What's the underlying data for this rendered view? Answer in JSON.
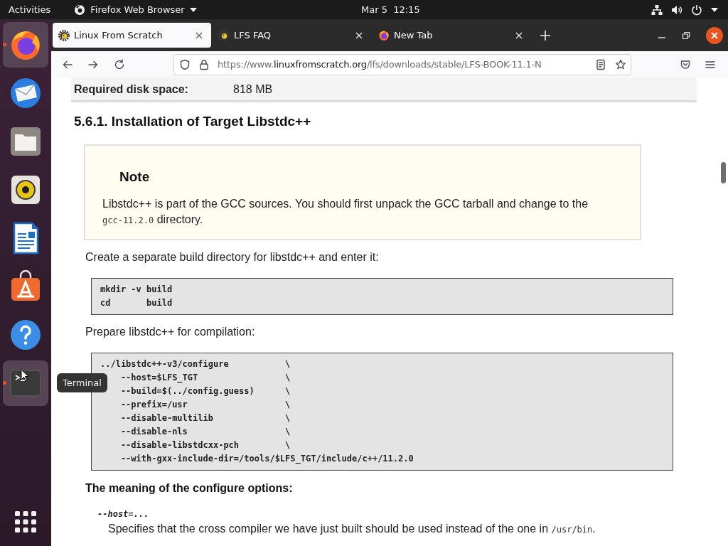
{
  "top_bar": {
    "activities": "Activities",
    "app_menu": "Firefox Web Browser",
    "clock": "Mar 5  12:15"
  },
  "dock": {
    "items": [
      {
        "kind": "browser",
        "running": true,
        "highlighted": true
      },
      {
        "kind": "mail",
        "running": false,
        "highlighted": false
      },
      {
        "kind": "files",
        "running": false,
        "highlighted": false
      },
      {
        "kind": "music",
        "running": false,
        "highlighted": false
      },
      {
        "kind": "writer",
        "running": false,
        "highlighted": false
      },
      {
        "kind": "software",
        "running": false,
        "highlighted": false
      },
      {
        "kind": "help",
        "running": false,
        "highlighted": false
      },
      {
        "kind": "terminal",
        "running": true,
        "highlighted": true
      }
    ],
    "tooltip": "Terminal"
  },
  "tabs": [
    {
      "title": "Linux From Scratch",
      "kind": "lfs",
      "selected": true
    },
    {
      "title": "LFS FAQ",
      "kind": "lfs",
      "selected": false
    },
    {
      "title": "New Tab",
      "kind": "browser",
      "selected": false
    }
  ],
  "address_bar": {
    "prefix": "https://www.",
    "domain": "linuxfromscratch.org",
    "path": "/lfs/downloads/stable/LFS-BOOK-11.1-N"
  },
  "page": {
    "blocks": [
      {
        "kind": "info_row",
        "label": "Required disk space:",
        "value": "818 MB"
      },
      {
        "kind": "heading",
        "text": "5.6.1. Installation of Target Libstdc++"
      },
      {
        "kind": "note",
        "title": "Note",
        "segments": [
          {
            "kind": "text",
            "text": "Libstdc++ is part of the GCC sources. You should first unpack the GCC tarball and change to the "
          },
          {
            "kind": "code",
            "text": "gcc-11.2.0"
          },
          {
            "kind": "text",
            "text": " directory."
          }
        ]
      },
      {
        "kind": "paragraph",
        "text": "Create a separate build directory for libstdc++ and enter it:"
      },
      {
        "kind": "code_block",
        "lines": [
          "mkdir -v build",
          "cd       build"
        ]
      },
      {
        "kind": "paragraph",
        "text": "Prepare libstdc++ for compilation:"
      },
      {
        "kind": "code_block",
        "lines": [
          "../libstdc++-v3/configure           \\",
          "    --host=$LFS_TGT                 \\",
          "    --build=$(../config.guess)      \\",
          "    --prefix=/usr                   \\",
          "    --disable-multilib              \\",
          "    --disable-nls                   \\",
          "    --disable-libstdcxx-pch         \\",
          "    --with-gxx-include-dir=/tools/$LFS_TGT/include/c++/11.2.0"
        ]
      },
      {
        "kind": "subheading",
        "text": "The meaning of the configure options:"
      },
      {
        "kind": "term",
        "text": "--host=..."
      },
      {
        "kind": "definition",
        "segments": [
          {
            "kind": "text",
            "text": "Specifies that the cross compiler we have just built should be used instead of the one in "
          },
          {
            "kind": "code",
            "text": "/usr/bin"
          },
          {
            "kind": "text",
            "text": "."
          }
        ]
      }
    ]
  }
}
